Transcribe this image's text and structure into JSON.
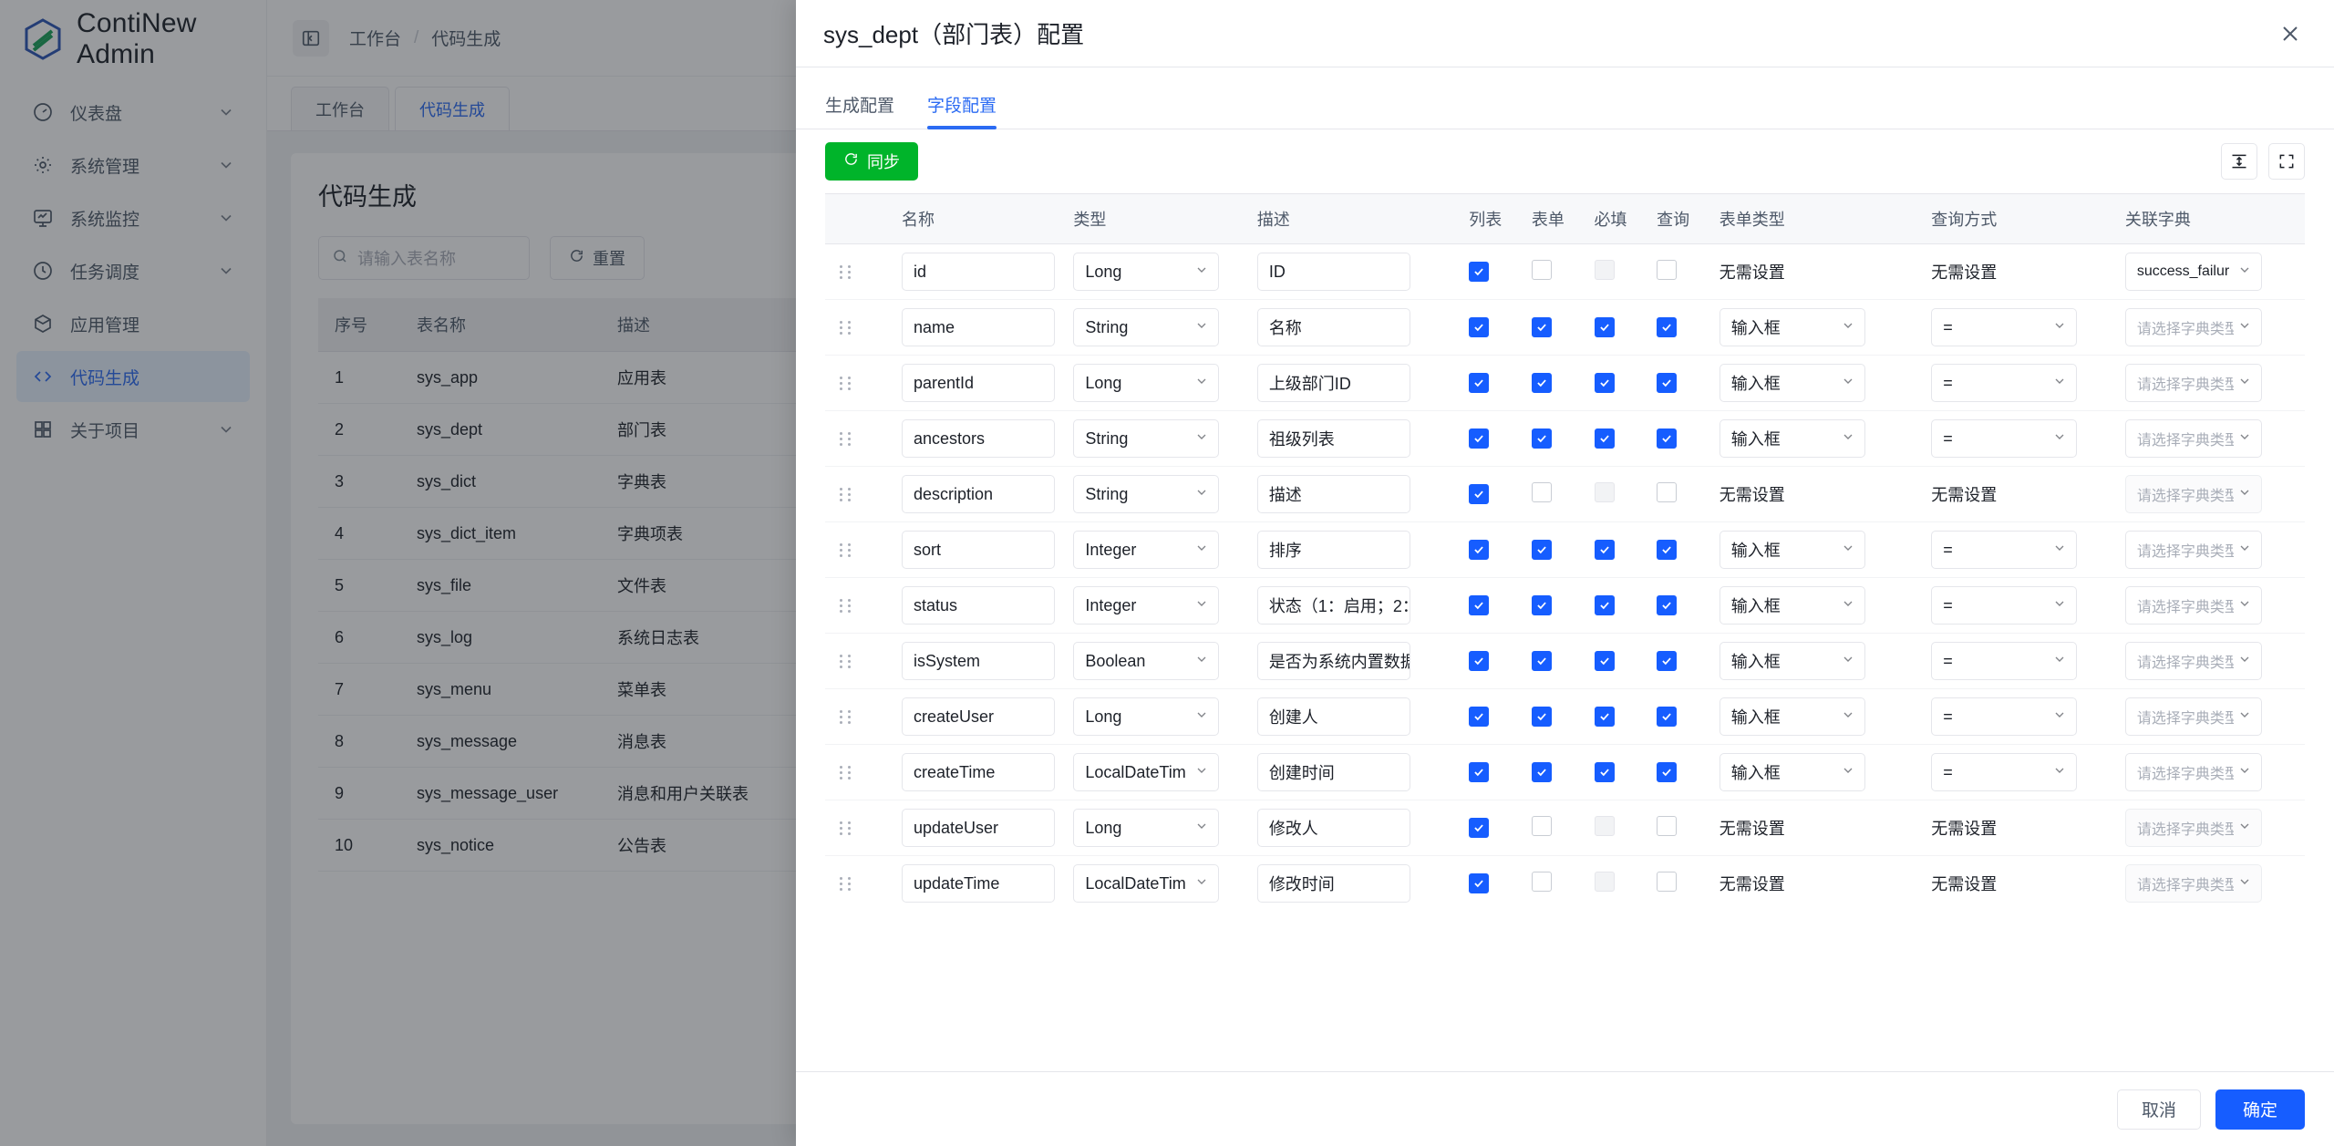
{
  "app": {
    "brand": "ContiNew Admin",
    "breadcrumb": [
      "工作台",
      "代码生成"
    ],
    "breadcrumb_sep": "/",
    "tabs": [
      {
        "label": "工作台",
        "active": false
      },
      {
        "label": "代码生成",
        "active": true
      }
    ]
  },
  "sidebar": {
    "items": [
      {
        "label": "仪表盘",
        "icon": "dashboard-icon",
        "chevron": true,
        "active": false
      },
      {
        "label": "系统管理",
        "icon": "gear-icon",
        "chevron": true,
        "active": false
      },
      {
        "label": "系统监控",
        "icon": "monitor-icon",
        "chevron": true,
        "active": false
      },
      {
        "label": "任务调度",
        "icon": "clock-icon",
        "chevron": true,
        "active": false
      },
      {
        "label": "应用管理",
        "icon": "box-icon",
        "chevron": false,
        "active": false
      },
      {
        "label": "代码生成",
        "icon": "code-icon",
        "chevron": false,
        "active": true
      },
      {
        "label": "关于项目",
        "icon": "grid-icon",
        "chevron": true,
        "active": false
      }
    ]
  },
  "page": {
    "title": "代码生成",
    "search_placeholder": "请输入表名称",
    "reset_label": "重置",
    "columns": [
      "序号",
      "表名称",
      "描述"
    ],
    "rows": [
      {
        "idx": "1",
        "name": "sys_app",
        "desc": "应用表"
      },
      {
        "idx": "2",
        "name": "sys_dept",
        "desc": "部门表"
      },
      {
        "idx": "3",
        "name": "sys_dict",
        "desc": "字典表"
      },
      {
        "idx": "4",
        "name": "sys_dict_item",
        "desc": "字典项表"
      },
      {
        "idx": "5",
        "name": "sys_file",
        "desc": "文件表"
      },
      {
        "idx": "6",
        "name": "sys_log",
        "desc": "系统日志表"
      },
      {
        "idx": "7",
        "name": "sys_menu",
        "desc": "菜单表"
      },
      {
        "idx": "8",
        "name": "sys_message",
        "desc": "消息表"
      },
      {
        "idx": "9",
        "name": "sys_message_user",
        "desc": "消息和用户关联表"
      },
      {
        "idx": "10",
        "name": "sys_notice",
        "desc": "公告表"
      }
    ]
  },
  "modal": {
    "title": "sys_dept（部门表）配置",
    "tabs": [
      {
        "label": "生成配置",
        "active": false
      },
      {
        "label": "字段配置",
        "active": true
      }
    ],
    "sync_label": "同步",
    "density_icon": "row-height-icon",
    "fullscreen_icon": "fullscreen-icon",
    "close_icon": "close-icon",
    "columns": [
      "名称",
      "类型",
      "描述",
      "列表",
      "表单",
      "必填",
      "查询",
      "表单类型",
      "查询方式",
      "关联字典"
    ],
    "no_setting_text": "无需设置",
    "dict_placeholder": "请选择字典类型",
    "accent_color": "#165dff",
    "sync_color": "#00b42a",
    "rows": [
      {
        "name": "id",
        "type": "Long",
        "desc": "ID",
        "list": true,
        "form": false,
        "required": false,
        "query": false,
        "form_type": "无需设置",
        "form_type_is_select": false,
        "query_type": "无需设置",
        "query_type_is_select": false,
        "dict": "success_failur",
        "dict_is_placeholder": false,
        "dict_disabled": false
      },
      {
        "name": "name",
        "type": "String",
        "desc": "名称",
        "list": true,
        "form": true,
        "required": true,
        "query": true,
        "form_type": "输入框",
        "form_type_is_select": true,
        "query_type": "=",
        "query_type_is_select": true,
        "dict": "请选择字典类型",
        "dict_is_placeholder": true,
        "dict_disabled": false
      },
      {
        "name": "parentId",
        "type": "Long",
        "desc": "上级部门ID",
        "list": true,
        "form": true,
        "required": true,
        "query": true,
        "form_type": "输入框",
        "form_type_is_select": true,
        "query_type": "=",
        "query_type_is_select": true,
        "dict": "请选择字典类型",
        "dict_is_placeholder": true,
        "dict_disabled": false
      },
      {
        "name": "ancestors",
        "type": "String",
        "desc": "祖级列表",
        "list": true,
        "form": true,
        "required": true,
        "query": true,
        "form_type": "输入框",
        "form_type_is_select": true,
        "query_type": "=",
        "query_type_is_select": true,
        "dict": "请选择字典类型",
        "dict_is_placeholder": true,
        "dict_disabled": false
      },
      {
        "name": "description",
        "type": "String",
        "desc": "描述",
        "list": true,
        "form": false,
        "required": false,
        "query": false,
        "form_type": "无需设置",
        "form_type_is_select": false,
        "query_type": "无需设置",
        "query_type_is_select": false,
        "dict": "请选择字典类型",
        "dict_is_placeholder": true,
        "dict_disabled": true
      },
      {
        "name": "sort",
        "type": "Integer",
        "desc": "排序",
        "list": true,
        "form": true,
        "required": true,
        "query": true,
        "form_type": "输入框",
        "form_type_is_select": true,
        "query_type": "=",
        "query_type_is_select": true,
        "dict": "请选择字典类型",
        "dict_is_placeholder": true,
        "dict_disabled": false
      },
      {
        "name": "status",
        "type": "Integer",
        "desc": "状态（1：启用；2：",
        "list": true,
        "form": true,
        "required": true,
        "query": true,
        "form_type": "输入框",
        "form_type_is_select": true,
        "query_type": "=",
        "query_type_is_select": true,
        "dict": "请选择字典类型",
        "dict_is_placeholder": true,
        "dict_disabled": false
      },
      {
        "name": "isSystem",
        "type": "Boolean",
        "desc": "是否为系统内置数据",
        "list": true,
        "form": true,
        "required": true,
        "query": true,
        "form_type": "输入框",
        "form_type_is_select": true,
        "query_type": "=",
        "query_type_is_select": true,
        "dict": "请选择字典类型",
        "dict_is_placeholder": true,
        "dict_disabled": false
      },
      {
        "name": "createUser",
        "type": "Long",
        "desc": "创建人",
        "list": true,
        "form": true,
        "required": true,
        "query": true,
        "form_type": "输入框",
        "form_type_is_select": true,
        "query_type": "=",
        "query_type_is_select": true,
        "dict": "请选择字典类型",
        "dict_is_placeholder": true,
        "dict_disabled": false
      },
      {
        "name": "createTime",
        "type": "LocalDateTim",
        "desc": "创建时间",
        "list": true,
        "form": true,
        "required": true,
        "query": true,
        "form_type": "输入框",
        "form_type_is_select": true,
        "query_type": "=",
        "query_type_is_select": true,
        "dict": "请选择字典类型",
        "dict_is_placeholder": true,
        "dict_disabled": false
      },
      {
        "name": "updateUser",
        "type": "Long",
        "desc": "修改人",
        "list": true,
        "form": false,
        "required": false,
        "query": false,
        "form_type": "无需设置",
        "form_type_is_select": false,
        "query_type": "无需设置",
        "query_type_is_select": false,
        "dict": "请选择字典类型",
        "dict_is_placeholder": true,
        "dict_disabled": true
      },
      {
        "name": "updateTime",
        "type": "LocalDateTim",
        "desc": "修改时间",
        "list": true,
        "form": false,
        "required": false,
        "query": false,
        "form_type": "无需设置",
        "form_type_is_select": false,
        "query_type": "无需设置",
        "query_type_is_select": false,
        "dict": "请选择字典类型",
        "dict_is_placeholder": true,
        "dict_disabled": true
      }
    ],
    "cancel_label": "取消",
    "ok_label": "确定"
  }
}
